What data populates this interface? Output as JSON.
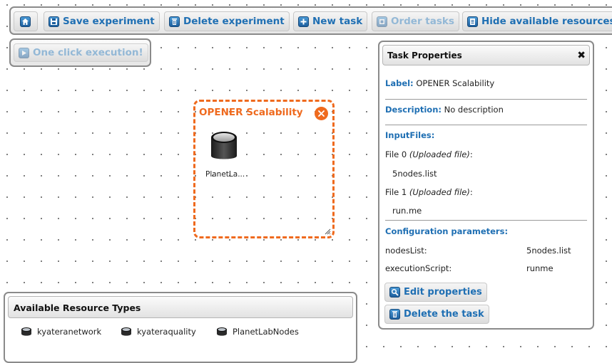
{
  "toolbar": {
    "save_label": "Save experiment",
    "delete_label": "Delete experiment",
    "new_task_label": "New task",
    "order_tasks_label": "Order tasks",
    "hide_resources_label": "Hide available resources"
  },
  "one_click": {
    "label": "One click execution!"
  },
  "experiment_task": {
    "title": "OPENER Scalability",
    "node_label": "PlanetLa..."
  },
  "task_properties": {
    "title": "Task Properties",
    "label_key": "Label:",
    "label_value": "OPENER Scalability",
    "description_key": "Description:",
    "description_value": "No description",
    "input_files_heading": "InputFiles:",
    "files": [
      {
        "name": "File 0",
        "type": "(Uploaded file)",
        "suffix": ":",
        "value": "5nodes.list"
      },
      {
        "name": "File 1",
        "type": "(Uploaded file)",
        "suffix": ":",
        "value": "run.me"
      }
    ],
    "config_heading": "Configuration parameters:",
    "params": [
      {
        "key": "nodesList:",
        "value": "5nodes.list"
      },
      {
        "key": "executionScript:",
        "value": "runme"
      }
    ],
    "edit_button": "Edit properties",
    "delete_button": "Delete the task"
  },
  "resources": {
    "title": "Available Resource Types",
    "items": [
      {
        "label": "kyateranetwork"
      },
      {
        "label": "kyateraquality"
      },
      {
        "label": "PlanetLabNodes"
      }
    ]
  },
  "colors": {
    "accent_blue": "#1f6fb3",
    "task_orange": "#ef6a1e",
    "border_gray": "#8a8a8a"
  },
  "icons": [
    "home-icon",
    "floppy-icon",
    "trash-icon",
    "plus-icon",
    "order-icon",
    "hide-icon",
    "play-icon",
    "close-icon",
    "database-icon",
    "search-icon",
    "resize-icon"
  ]
}
